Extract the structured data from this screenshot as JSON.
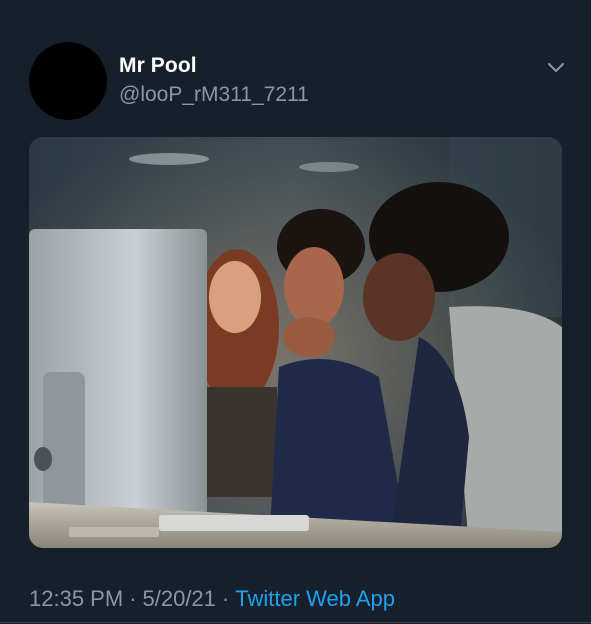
{
  "tweet": {
    "author": {
      "display_name": "Mr Pool",
      "handle": "@looP_rM311_7211"
    },
    "time": "12:35 PM",
    "date": "5/20/21",
    "source": "Twitter Web App",
    "menu_icon": "chevron-down-icon"
  },
  "colors": {
    "background": "#15202b",
    "primary_text": "#ffffff",
    "secondary_text": "#8899a6",
    "link": "#1da1f2"
  }
}
